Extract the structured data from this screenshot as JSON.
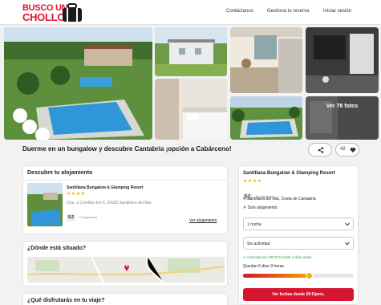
{
  "brand": {
    "line1": "BUSCO UN",
    "line2": "CHOLLO",
    "color": "#e0152f"
  },
  "nav": {
    "contact": "Contáctanos",
    "manage": "Gestiona tu reserva",
    "login": "Iniciar sesión"
  },
  "gallery": {
    "more_photos": "Ver 78 fotos"
  },
  "headline": "Duerme en un bungalow y descubre Cantabria ¡opción a Cabárceno!",
  "favorites_count": "42",
  "accommodation_card": {
    "heading": "Descubre tu alojamiento",
    "hotel_name": "Santillana Bungalow & Glamping Resort",
    "stars": 4,
    "address": "Ctra. a Comillas km 6, 39330 Santillana del Mar",
    "score": "9.2",
    "reviews": "70 opiniones",
    "link": "Ver alojamiento"
  },
  "location_card": {
    "heading": "¿Dónde está situado?"
  },
  "enjoy_card": {
    "heading": "¿Qué disfrutarás en tu viaje?"
  },
  "booking": {
    "hotel_name": "Santillana Bungalow & Glamping Resort",
    "stars": 4,
    "score": "9.2",
    "reviews": "70 opiniones",
    "location": "Santillana del Mar, Costa de Cantabria",
    "board": "Solo alojamiento",
    "nights_select": "1 noche",
    "activity_select": "Sin actividad",
    "cancellation": "Cancelación GRATIS hasta 4 días antes",
    "countdown": "Quedan 6 días 9 horas",
    "time_progress": 0.6,
    "cta": "Ver fechas desde 29 €/pers."
  },
  "colors": {
    "accent": "#d61531",
    "star": "#f2b400",
    "success": "#2e9e45"
  }
}
